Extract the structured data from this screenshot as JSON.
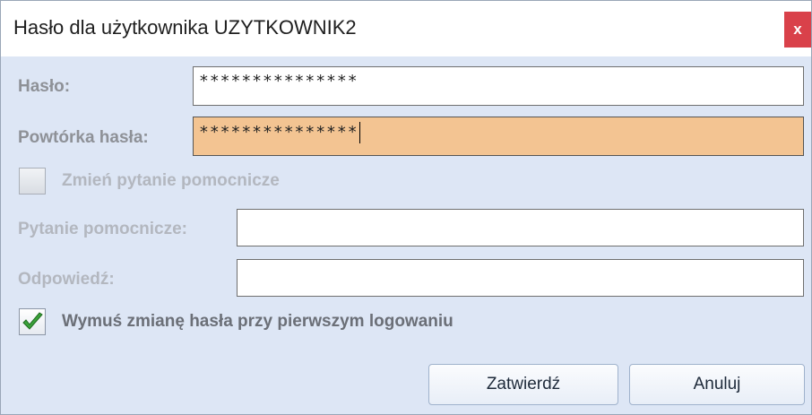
{
  "window": {
    "title": "Hasło dla użytkownika UZYTKOWNIK2",
    "close_label": "x"
  },
  "form": {
    "password_label": "Hasło:",
    "password_value": "***************",
    "repeat_label": "Powtórka hasła:",
    "repeat_value": "***************",
    "change_question_label": "Zmień pytanie pomocnicze",
    "change_question_checked": false,
    "question_label": "Pytanie pomocnicze:",
    "question_value": "",
    "answer_label": "Odpowiedź:",
    "answer_value": "",
    "force_change_label": "Wymuś zmianę hasła przy pierwszym logowaniu",
    "force_change_checked": true
  },
  "buttons": {
    "confirm_label": "Zatwierdź",
    "cancel_label": "Anuluj"
  },
  "colors": {
    "focused_field": "#f3c492",
    "close_button": "#d9414a",
    "dialog_background": "#dde6f5",
    "check_mark": "#3aa23a"
  },
  "icons": {
    "close": "close-icon",
    "check": "check-icon"
  }
}
